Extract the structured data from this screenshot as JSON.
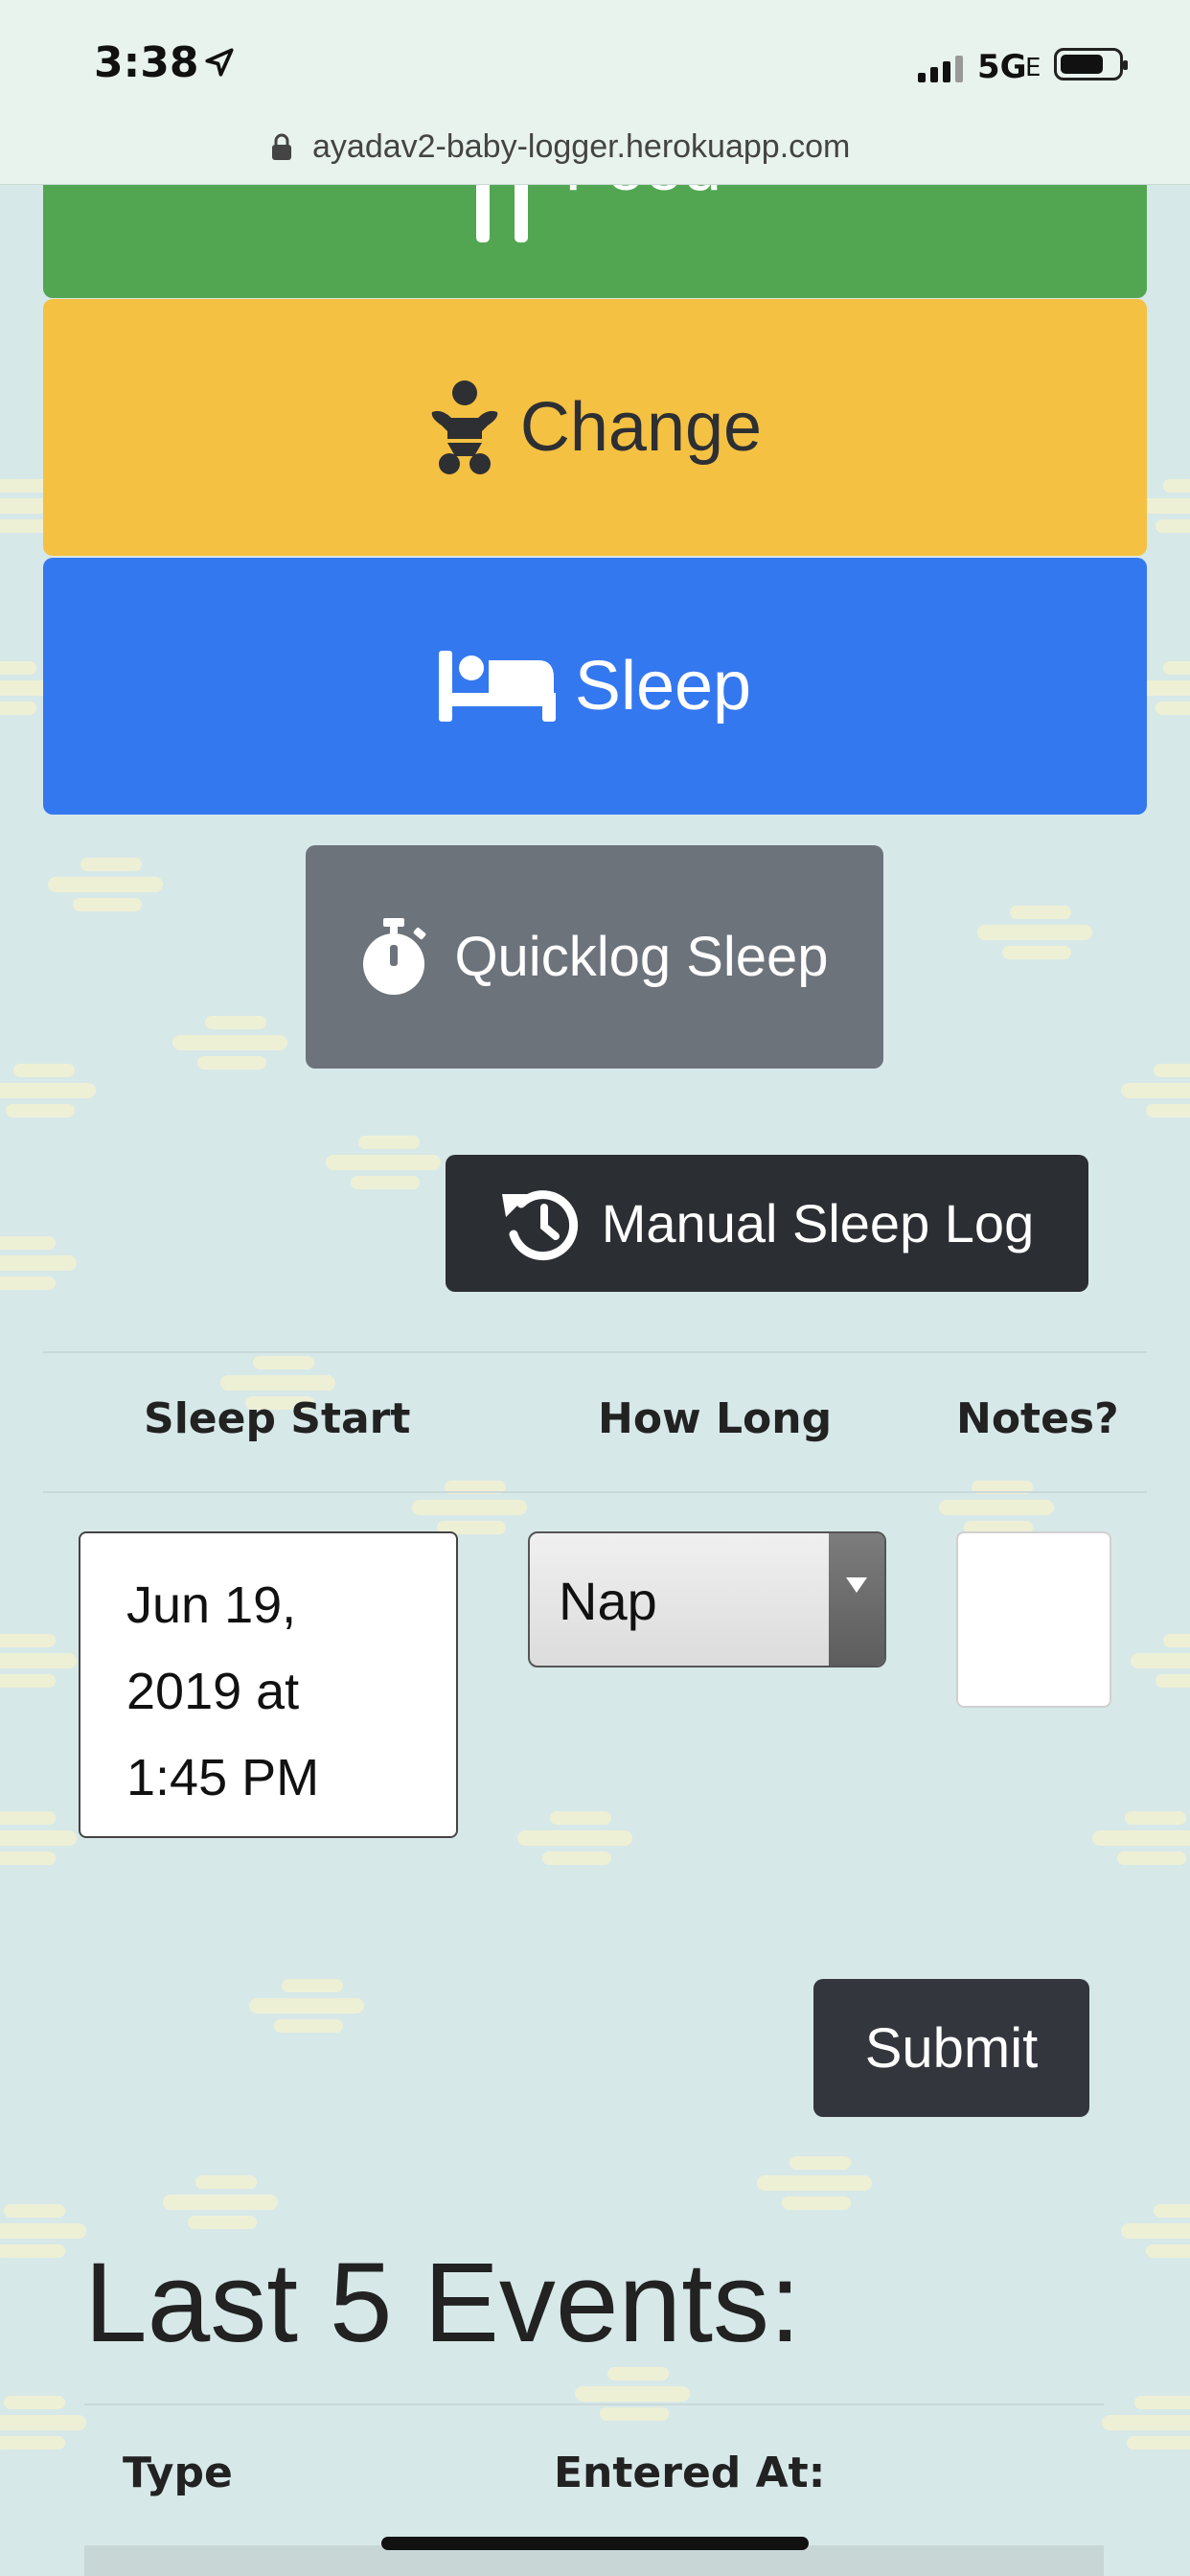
{
  "status_bar": {
    "time": "3:38",
    "network": "5G",
    "network_sub": "E"
  },
  "browser": {
    "url": "ayadav2-baby-logger.herokuapp.com"
  },
  "buttons": {
    "food": "Food",
    "change": "Change",
    "sleep": "Sleep",
    "quicklog_sleep": "Quicklog Sleep",
    "manual_sleep_log": "Manual Sleep Log",
    "submit": "Submit"
  },
  "form": {
    "headers": {
      "sleep_start": "Sleep Start",
      "how_long": "How Long",
      "notes": "Notes?"
    },
    "sleep_start_line1": "Jun 19,",
    "sleep_start_line2": "2019 at",
    "sleep_start_line3": "1:45 PM",
    "how_long_value": "Nap",
    "notes_value": ""
  },
  "events": {
    "title": "Last 5 Events:",
    "columns": [
      "Type",
      "Entered At:"
    ]
  },
  "colors": {
    "food": "#52a652",
    "change": "#f4c142",
    "sleep": "#3478f0",
    "quicklog": "#6d737b",
    "dark": "#2b2e33",
    "background": "#d7e8e8"
  },
  "icons": {
    "food": "utensils-icon",
    "change": "baby-icon",
    "sleep": "bed-icon",
    "quicklog": "stopwatch-icon",
    "manual": "history-icon"
  }
}
